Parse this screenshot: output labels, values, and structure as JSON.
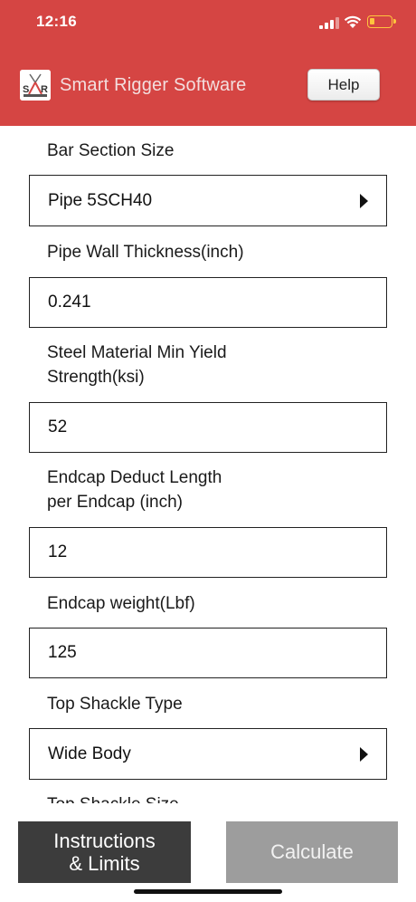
{
  "status_bar": {
    "time": "12:16"
  },
  "header": {
    "app_title": "Smart Rigger Software",
    "help_label": "Help",
    "logo_text": "SR"
  },
  "form": {
    "bar_section_size": {
      "label": "Bar Section Size",
      "value": "Pipe 5SCH40"
    },
    "pipe_wall_thickness": {
      "label": "Pipe Wall Thickness(inch)",
      "value": "0.241"
    },
    "steel_yield": {
      "label_line1": "Steel Material Min Yield",
      "label_line2": "Strength(ksi)",
      "value": "52"
    },
    "endcap_deduct": {
      "label_line1": "Endcap Deduct Length",
      "label_line2": "per Endcap (inch)",
      "value": "12"
    },
    "endcap_weight": {
      "label": "Endcap weight(Lbf)",
      "value": "125"
    },
    "top_shackle_type": {
      "label": "Top Shackle Type",
      "value": "Wide Body"
    },
    "top_shackle_size": {
      "label": "Top Shackle Size"
    }
  },
  "bottom": {
    "instructions_label": "Instructions\n& Limits",
    "calculate_label": "Calculate"
  },
  "colors": {
    "header_bg": "#d54543",
    "instructions_bg": "#3c3c3c",
    "calculate_bg": "#9d9d9d"
  },
  "icons": {
    "dropdown": "triangle-right-icon",
    "signal": "cellular-signal-icon",
    "wifi": "wifi-icon",
    "battery": "battery-low-icon"
  }
}
